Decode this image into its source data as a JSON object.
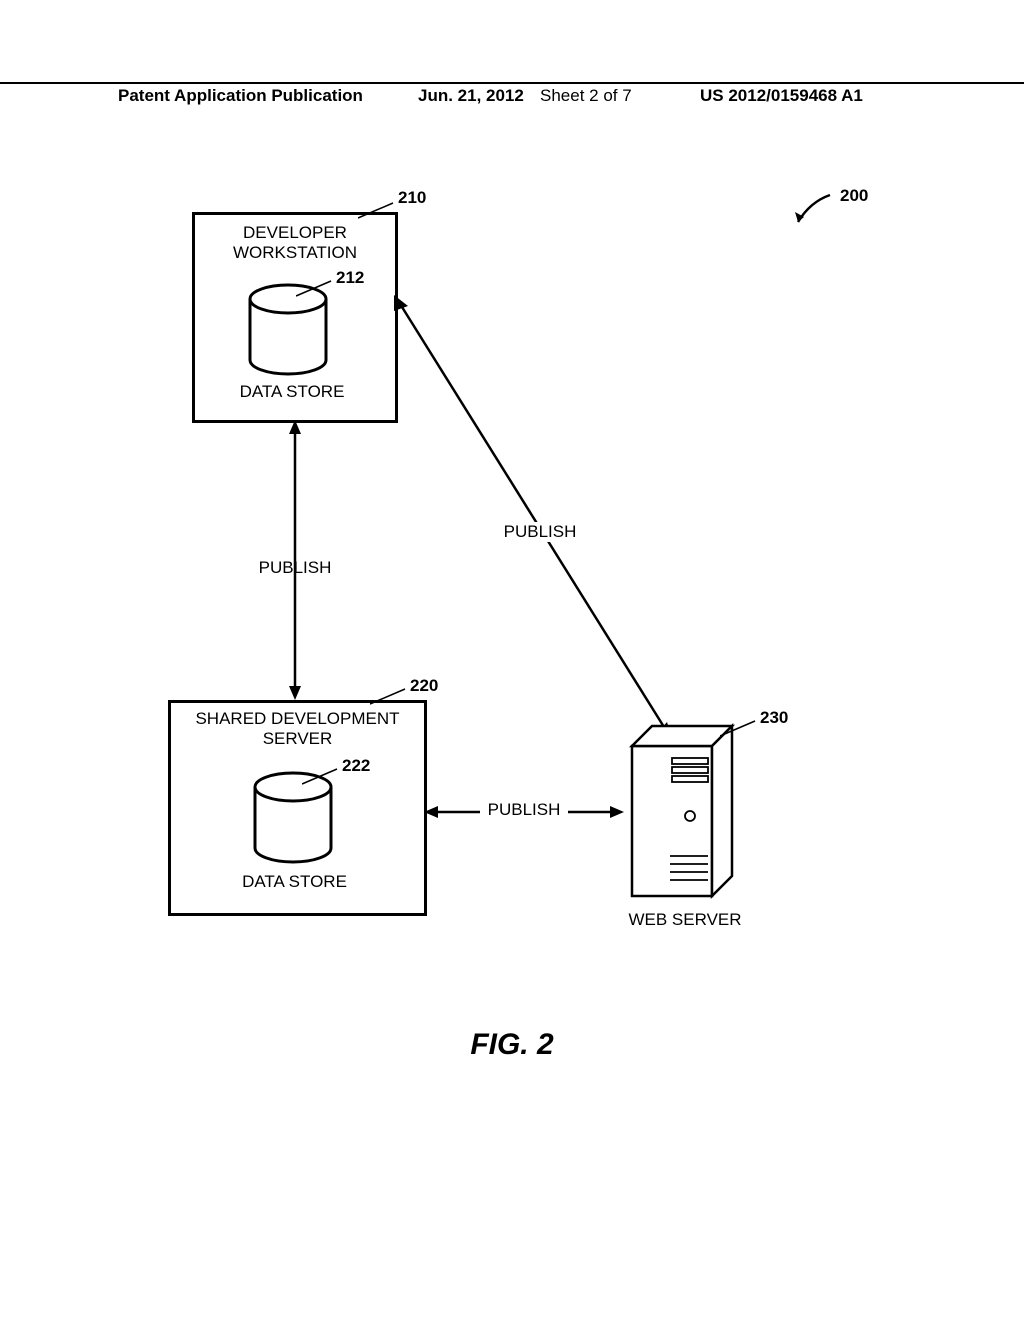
{
  "header": {
    "publication": "Patent Application Publication",
    "date": "Jun. 21, 2012",
    "sheet": "Sheet 2 of 7",
    "pubnum": "US 2012/0159468 A1"
  },
  "refs": {
    "r200": "200",
    "r210": "210",
    "r212": "212",
    "r220": "220",
    "r222": "222",
    "r230": "230"
  },
  "boxes": {
    "workstation_title": "DEVELOPER\nWORKSTATION",
    "workstation_ds": "DATA STORE",
    "server_title": "SHARED DEVELOPMENT\nSERVER",
    "server_ds": "DATA STORE",
    "webserver": "WEB SERVER"
  },
  "arrows": {
    "publish1": "PUBLISH",
    "publish2": "PUBLISH",
    "publish3": "PUBLISH"
  },
  "figure": "FIG. 2"
}
